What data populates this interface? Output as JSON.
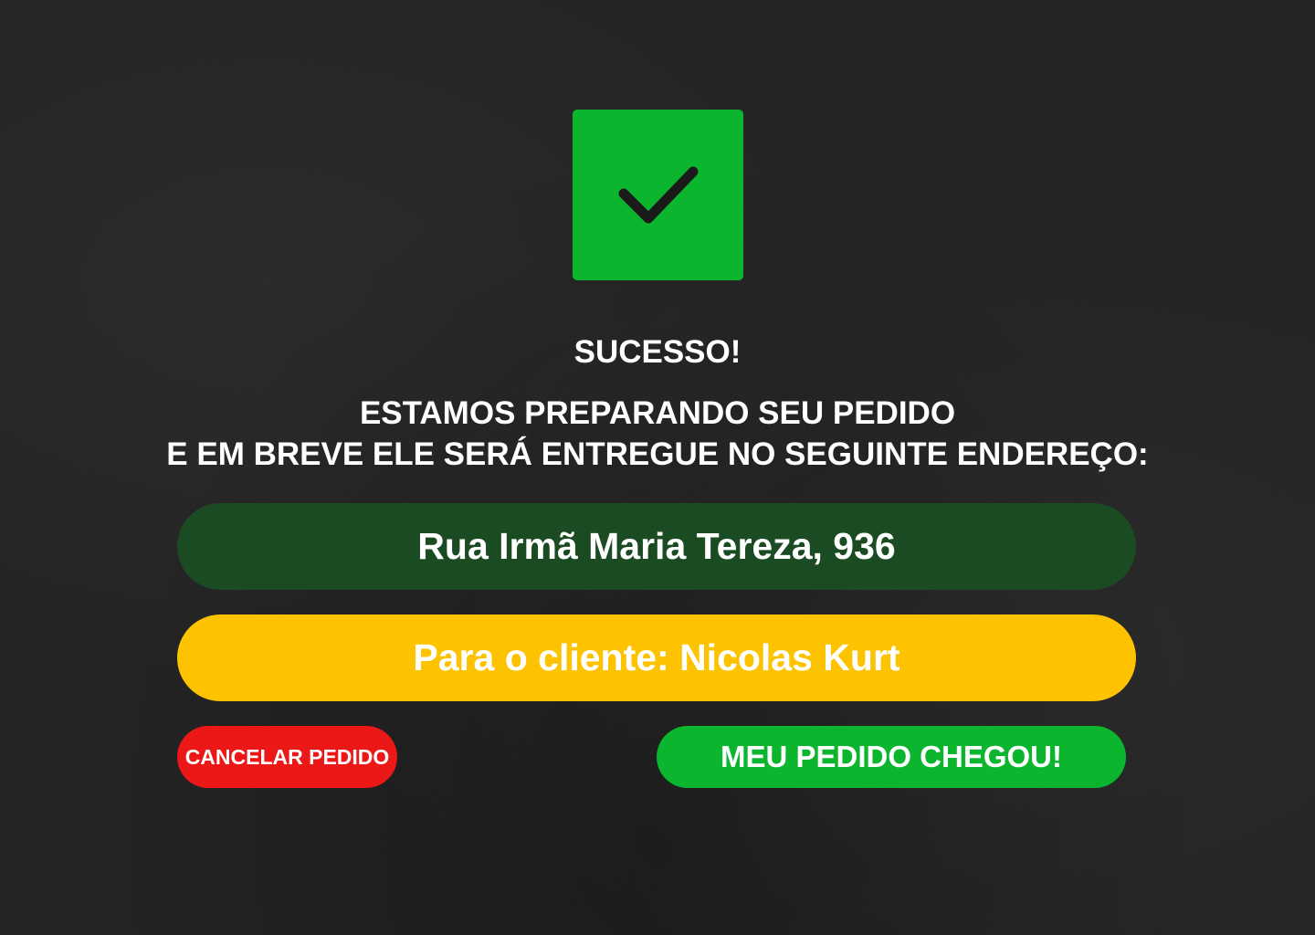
{
  "icon": {
    "name": "checkmark-icon",
    "bg_color": "#0bb52e",
    "stroke_color": "#1a1a1a"
  },
  "title": "SUCESSO!",
  "message": {
    "line1": "ESTAMOS PREPARANDO SEU PEDIDO",
    "line2": "E EM BREVE ELE SERÁ ENTREGUE NO SEGUINTE ENDEREÇO:"
  },
  "address": {
    "text": "Rua Irmã Maria Tereza, 936",
    "bg_color": "#1b4b23"
  },
  "client": {
    "text": "Para o cliente: Nicolas Kurt",
    "bg_color": "#fec300"
  },
  "actions": {
    "cancel_label": "CANCELAR PEDIDO",
    "cancel_color": "#ec1717",
    "arrived_label": "MEU PEDIDO CHEGOU!",
    "arrived_color": "#0bb52e"
  }
}
